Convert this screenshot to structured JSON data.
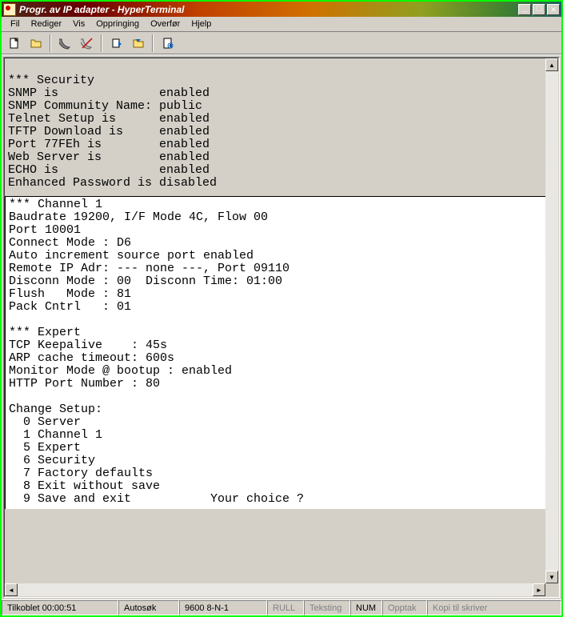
{
  "title": "Progr. av IP adapter - HyperTerminal",
  "menus": {
    "fil": "Fil",
    "rediger": "Rediger",
    "vis": "Vis",
    "oppringing": "Oppringing",
    "overfoer": "Overfør",
    "hjelp": "Hjelp"
  },
  "toolbar_icons": {
    "new": "new-icon",
    "open": "open-icon",
    "connect": "connect-icon",
    "disconnect": "disconnect-icon",
    "send": "send-icon",
    "receive": "receive-icon",
    "properties": "properties-icon"
  },
  "terminal": {
    "security_lines": "*** Security\nSNMP is              enabled\nSNMP Community Name: public\nTelnet Setup is      enabled\nTFTP Download is     enabled\nPort 77FEh is        enabled\nWeb Server is        enabled\nECHO is              enabled\nEnhanced Password is disabled",
    "channel_lines": "*** Channel 1\nBaudrate 19200, I/F Mode 4C, Flow 00\nPort 10001\nConnect Mode : D6\nAuto increment source port enabled\nRemote IP Adr: --- none ---, Port 09110\nDisconn Mode : 00  Disconn Time: 01:00\nFlush   Mode : 81\nPack Cntrl   : 01\n\n*** Expert\nTCP Keepalive    : 45s\nARP cache timeout: 600s\nMonitor Mode @ bootup : enabled\nHTTP Port Number : 80\n\nChange Setup:\n  0 Server\n  1 Channel 1\n  5 Expert\n  6 Security\n  7 Factory defaults\n  8 Exit without save\n  9 Save and exit           Your choice ? "
  },
  "status": {
    "tilkoblet": "Tilkoblet 00:00:51",
    "autosok": "Autosøk",
    "baud": "9600 8-N-1",
    "rull": "RULL",
    "teksting": "Teksting",
    "num": "NUM",
    "opptak": "Opptak",
    "kopi": "Kopi til skriver"
  },
  "winbtn": {
    "min": "_",
    "max": "□",
    "close": "✕"
  },
  "scrollglyph": {
    "up": "▲",
    "down": "▼",
    "left": "◄",
    "right": "►"
  }
}
